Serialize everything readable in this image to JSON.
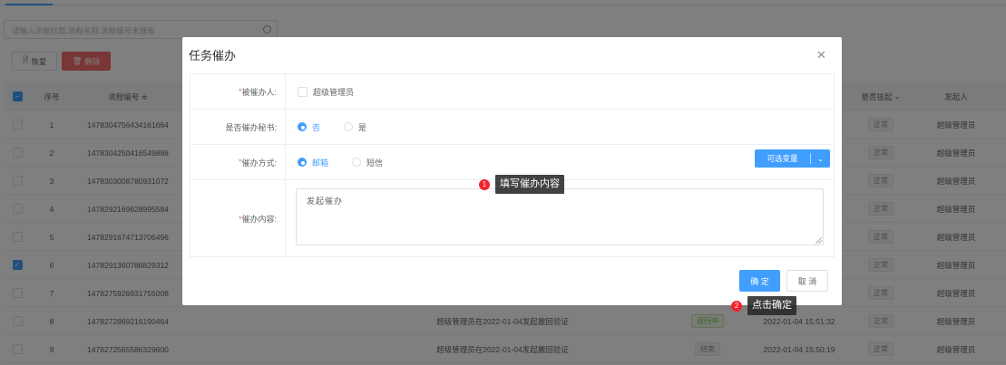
{
  "search": {
    "placeholder": "请输入流程标题,流程名称,流程编号来搜索"
  },
  "toolbar": {
    "restore_icon": "document-icon",
    "restore_label": "恢复",
    "delete_icon": "trash-icon",
    "delete_label": "删除"
  },
  "table": {
    "headers": {
      "index": "序号",
      "process_no": "流程编号 ≑",
      "suspended": "是否挂起",
      "initiator": "发起人"
    },
    "rows": [
      {
        "index": "1",
        "process_no": "1478304756434161664",
        "title": "",
        "status": "",
        "time": "",
        "suspended": "正常",
        "initiator": "超级管理员",
        "checked": false
      },
      {
        "index": "2",
        "process_no": "1478304250416549888",
        "title": "",
        "status": "",
        "time": "",
        "suspended": "正常",
        "initiator": "超级管理员",
        "checked": false
      },
      {
        "index": "3",
        "process_no": "1478303008780931072",
        "title": "",
        "status": "",
        "time": "",
        "suspended": "正常",
        "initiator": "超级管理员",
        "checked": false
      },
      {
        "index": "4",
        "process_no": "1478292169628995584",
        "title": "",
        "status": "",
        "time": "",
        "suspended": "正常",
        "initiator": "超级管理员",
        "checked": false
      },
      {
        "index": "5",
        "process_no": "1478291674713706496",
        "title": "",
        "status": "",
        "time": "",
        "suspended": "正常",
        "initiator": "超级管理员",
        "checked": false
      },
      {
        "index": "6",
        "process_no": "1478291360786829312",
        "title": "",
        "status": "",
        "time": "",
        "suspended": "正常",
        "initiator": "超级管理员",
        "checked": true
      },
      {
        "index": "7",
        "process_no": "1478275926931755008",
        "title": "",
        "status": "",
        "time": "",
        "suspended": "正常",
        "initiator": "超级管理员",
        "checked": false
      },
      {
        "index": "8",
        "process_no": "1478272869216190464",
        "title": "超级管理员在2022-01-04发起撤回验证",
        "status": "运行中",
        "time": "2022-01-04 15:51:32",
        "suspended": "正常",
        "initiator": "超级管理员",
        "checked": false
      },
      {
        "index": "9",
        "process_no": "1478272565586329600",
        "title": "超级管理员在2022-01-04发起撤回验证",
        "status": "结束",
        "time": "2022-01-04 15:50:19",
        "suspended": "正常",
        "initiator": "超级管理员",
        "checked": false
      }
    ]
  },
  "dialog": {
    "title": "任务催办",
    "close_icon": "close-icon",
    "form": {
      "handler_label": "被催办人:",
      "handler_option": "超级管理员",
      "secretary_label": "是否催办秘书:",
      "secretary_no": "否",
      "secretary_yes": "是",
      "method_label": "催办方式:",
      "method_email": "邮箱",
      "method_sms": "短信",
      "variables_button": "可选变量",
      "content_label": "催办内容:",
      "content_value": "发起催办"
    },
    "ok_label": "确 定",
    "cancel_label": "取 消"
  },
  "callouts": [
    {
      "num": "1",
      "text": "填写催办内容"
    },
    {
      "num": "2",
      "text": "点击确定"
    }
  ],
  "colors": {
    "primary": "#409eff",
    "danger": "#f56c6c",
    "success": "#67c23a",
    "badge": "#f5222d"
  }
}
